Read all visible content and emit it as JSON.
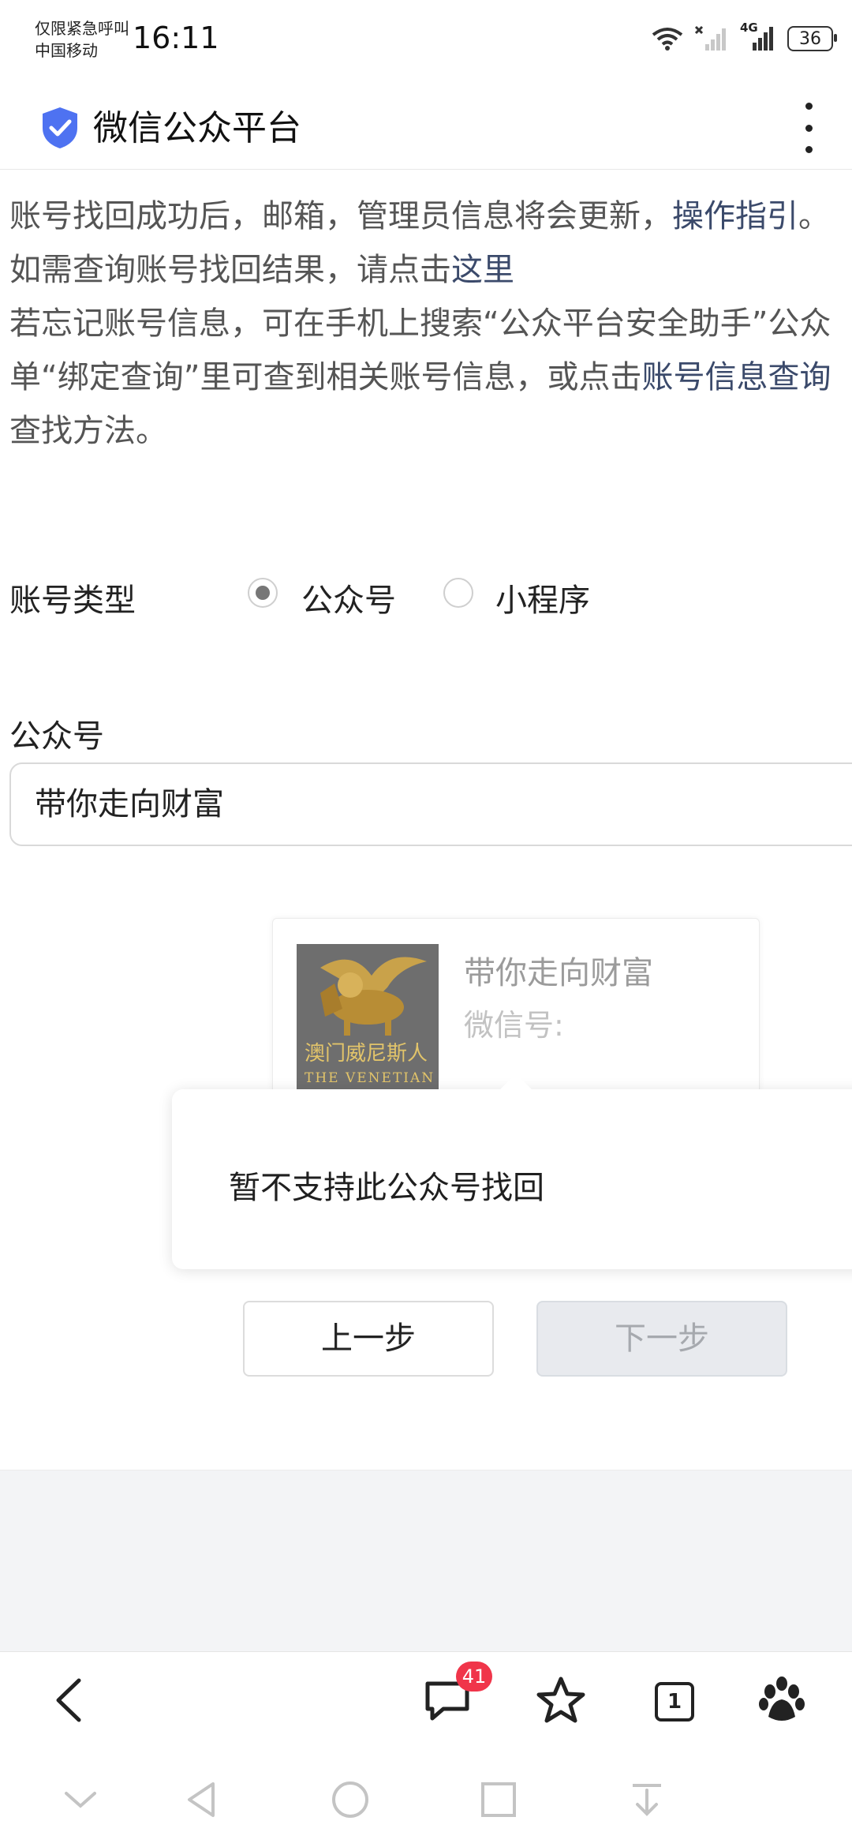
{
  "status_bar": {
    "carrier_line1": "仅限紧急呼叫",
    "carrier_line2": "中国移动",
    "time": "16:11",
    "network": "4G",
    "battery": "36",
    "icons": [
      "wifi-icon",
      "no-sim-signal-icon",
      "cell-signal-icon",
      "battery-icon"
    ]
  },
  "header": {
    "title": "微信公众平台",
    "icons": [
      "shield-check-icon",
      "more-vertical-icon"
    ],
    "accent_color": "#4e72f1"
  },
  "intro": {
    "line1_text": "账号找回成功后，邮箱，管理员信息将会更新，",
    "line1_link": "操作指引",
    "line1_end": "。",
    "line2_text": "如需查询账号找回结果，请点击",
    "line2_link": "这里",
    "line3_text": "若忘记账号信息，可在手机上搜索“公众平台安全助手”公众",
    "line4_text": "单“绑定查询”里可查到相关账号信息，或点击",
    "line4_link": "账号信息查询",
    "line5_text": "查找方法。"
  },
  "form": {
    "account_type_label": "账号类型",
    "option_official": "公众号",
    "option_miniprogram": "小程序",
    "selected_option": "公众号",
    "field_label": "公众号",
    "field_value": "带你走向财富"
  },
  "result_card": {
    "name": "带你走向财富",
    "wechat_id_label": "微信号:",
    "avatar_caption": "澳门威尼斯人",
    "avatar_caption_en": "THE VENETIAN"
  },
  "toast": {
    "message": "暂不支持此公众号找回"
  },
  "actions": {
    "prev_label": "上一步",
    "next_label": "下一步"
  },
  "browser_toolbar": {
    "icons": [
      "back-icon",
      "comment-icon",
      "star-icon",
      "tabs-icon",
      "baidu-paw-icon"
    ],
    "message_badge": "41",
    "tab_count": "1",
    "badge_color": "#f0354a"
  },
  "navbar": {
    "icons": [
      "collapse-down-icon",
      "nav-back-icon",
      "nav-home-icon",
      "nav-recents-icon",
      "nav-download-icon"
    ]
  }
}
